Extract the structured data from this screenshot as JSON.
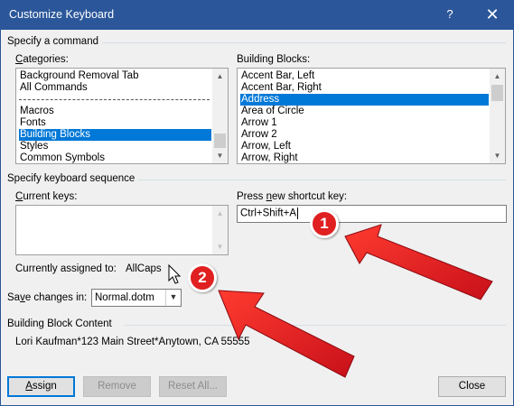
{
  "window": {
    "title": "Customize Keyboard",
    "help_glyph": "?",
    "close_glyph": "✕"
  },
  "specify_command": {
    "group_label": "Specify a command",
    "categories_label": "Categories:",
    "categories": [
      {
        "label": "Background Removal Tab",
        "selected": false
      },
      {
        "label": "All Commands",
        "selected": false
      },
      {
        "separator": true
      },
      {
        "label": "Macros",
        "selected": false
      },
      {
        "label": "Fonts",
        "selected": false
      },
      {
        "label": "Building Blocks",
        "selected": true
      },
      {
        "label": "Styles",
        "selected": false
      },
      {
        "label": "Common Symbols",
        "selected": false
      }
    ],
    "building_blocks_label": "Building Blocks:",
    "building_blocks": [
      {
        "label": "Accent Bar, Left",
        "selected": false
      },
      {
        "label": "Accent Bar, Right",
        "selected": false
      },
      {
        "label": "Address",
        "selected": true
      },
      {
        "label": "Area of Circle",
        "selected": false
      },
      {
        "label": "Arrow 1",
        "selected": false
      },
      {
        "label": "Arrow 2",
        "selected": false
      },
      {
        "label": "Arrow, Left",
        "selected": false
      },
      {
        "label": "Arrow, Right",
        "selected": false
      }
    ]
  },
  "keyboard_sequence": {
    "group_label": "Specify keyboard sequence",
    "current_keys_label": "Current keys:",
    "new_shortcut_label": "Press new shortcut key:",
    "new_shortcut_value": "Ctrl+Shift+A",
    "currently_assigned_label": "Currently assigned to:",
    "currently_assigned_value": "AllCaps",
    "save_changes_label": "Save changes in:",
    "save_changes_value": "Normal.dotm"
  },
  "building_block_content": {
    "group_label": "Building Block Content",
    "text": "Lori Kaufman*123 Main Street*Anytown, CA 55555"
  },
  "buttons": {
    "assign": "Assign",
    "remove": "Remove",
    "reset_all": "Reset All...",
    "close": "Close"
  },
  "annotations": {
    "badge_1": "1",
    "badge_2": "2",
    "arrow_color": "#e8141b"
  },
  "colors": {
    "titlebar": "#2b579a",
    "selection": "#0078d7"
  }
}
